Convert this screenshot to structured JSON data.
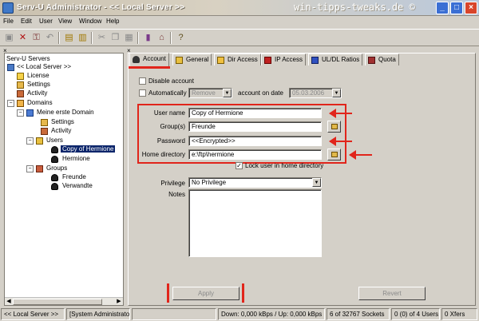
{
  "window": {
    "title": "Serv-U Administrator - << Local Server >>",
    "watermark": "win-tipps-tweaks.de ©"
  },
  "menu": [
    "File",
    "Edit",
    "User",
    "View",
    "Window",
    "Help"
  ],
  "tree": {
    "close_glyph": "×",
    "root": "Serv-U Servers",
    "server": "<< Local Server >>",
    "license": "License",
    "settings": "Settings",
    "activity": "Activity",
    "domains": "Domains",
    "domain": "Meine erste Domain",
    "domain_settings": "Settings",
    "domain_activity": "Activity",
    "users": "Users",
    "user_selected": "Copy of Hermione",
    "user_2": "Hermione",
    "groups": "Groups",
    "group_1": "Freunde",
    "group_2": "Verwandte",
    "expand_minus": "−"
  },
  "tabs": [
    "Account",
    "General",
    "Dir Access",
    "IP Access",
    "UL/DL Ratios",
    "Quota"
  ],
  "account": {
    "disable_label": "Disable account",
    "auto_label": "Automatically",
    "auto_action": "Remove",
    "on_date_label": "account on date",
    "on_date_value": "05.03.2006",
    "username_label": "User name",
    "username_value": "Copy of Hermione",
    "groups_label": "Group(s)",
    "groups_value": "Freunde",
    "password_label": "Password",
    "password_value": "<<Encrypted>>",
    "homedir_label": "Home directory",
    "homedir_value": "e:\\ftp\\hermione",
    "lock_label": "Lock user in home directory",
    "privilege_label": "Privilege",
    "privilege_value": "No Privilege",
    "notes_label": "Notes"
  },
  "buttons": {
    "apply": "Apply",
    "revert": "Revert"
  },
  "status": {
    "server": "<< Local Server >>",
    "role": "[System Administrator]",
    "speed": "Down: 0,000 kBps / Up: 0,000 kBps",
    "sockets": "6 of 32767 Sockets",
    "users": "0 (0) of 4 Users",
    "xfers": "0 Xfers"
  },
  "colors": {
    "annotation": "#e1251b",
    "selection": "#0a246a"
  }
}
